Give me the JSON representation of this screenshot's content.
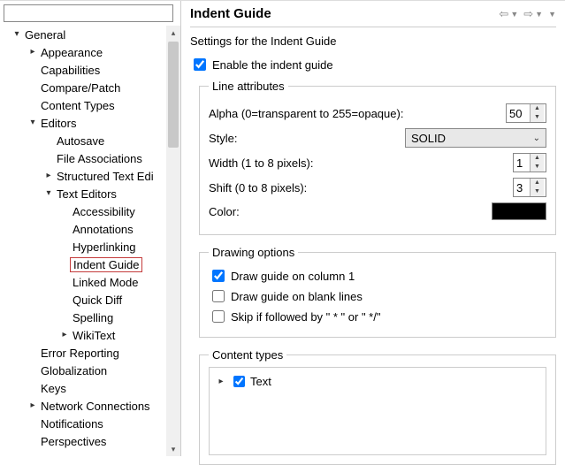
{
  "tree": {
    "general": "General",
    "appearance": "Appearance",
    "capabilities": "Capabilities",
    "compare": "Compare/Patch",
    "contenttypes": "Content Types",
    "editors": "Editors",
    "autosave": "Autosave",
    "fileassoc": "File Associations",
    "structured": "Structured Text Edi",
    "texteditors": "Text Editors",
    "accessibility": "Accessibility",
    "annotations": "Annotations",
    "hyperlinking": "Hyperlinking",
    "indentguide": "Indent Guide",
    "linkedmode": "Linked Mode",
    "quickdiff": "Quick Diff",
    "spelling": "Spelling",
    "wikitext": "WikiText",
    "errorreporting": "Error Reporting",
    "globalization": "Globalization",
    "keys": "Keys",
    "network": "Network Connections",
    "notifications": "Notifications",
    "perspectives": "Perspectives"
  },
  "header": {
    "title": "Indent Guide"
  },
  "desc": "Settings for the Indent Guide",
  "enable_label": "Enable the indent guide",
  "lineattr": {
    "legend": "Line attributes",
    "alpha_label": "Alpha (0=transparent to 255=opaque):",
    "alpha_value": "50",
    "style_label": "Style:",
    "style_value": "SOLID",
    "width_label": "Width (1 to 8 pixels):",
    "width_value": "1",
    "shift_label": "Shift (0 to 8 pixels):",
    "shift_value": "3",
    "color_label": "Color:"
  },
  "drawing": {
    "legend": "Drawing options",
    "col1": "Draw guide on column 1",
    "blank": "Draw guide on blank lines",
    "skip": "Skip if followed by \" * \" or \" */\""
  },
  "content": {
    "legend": "Content types",
    "text": "Text"
  },
  "filter": {
    "placeholder": ""
  }
}
